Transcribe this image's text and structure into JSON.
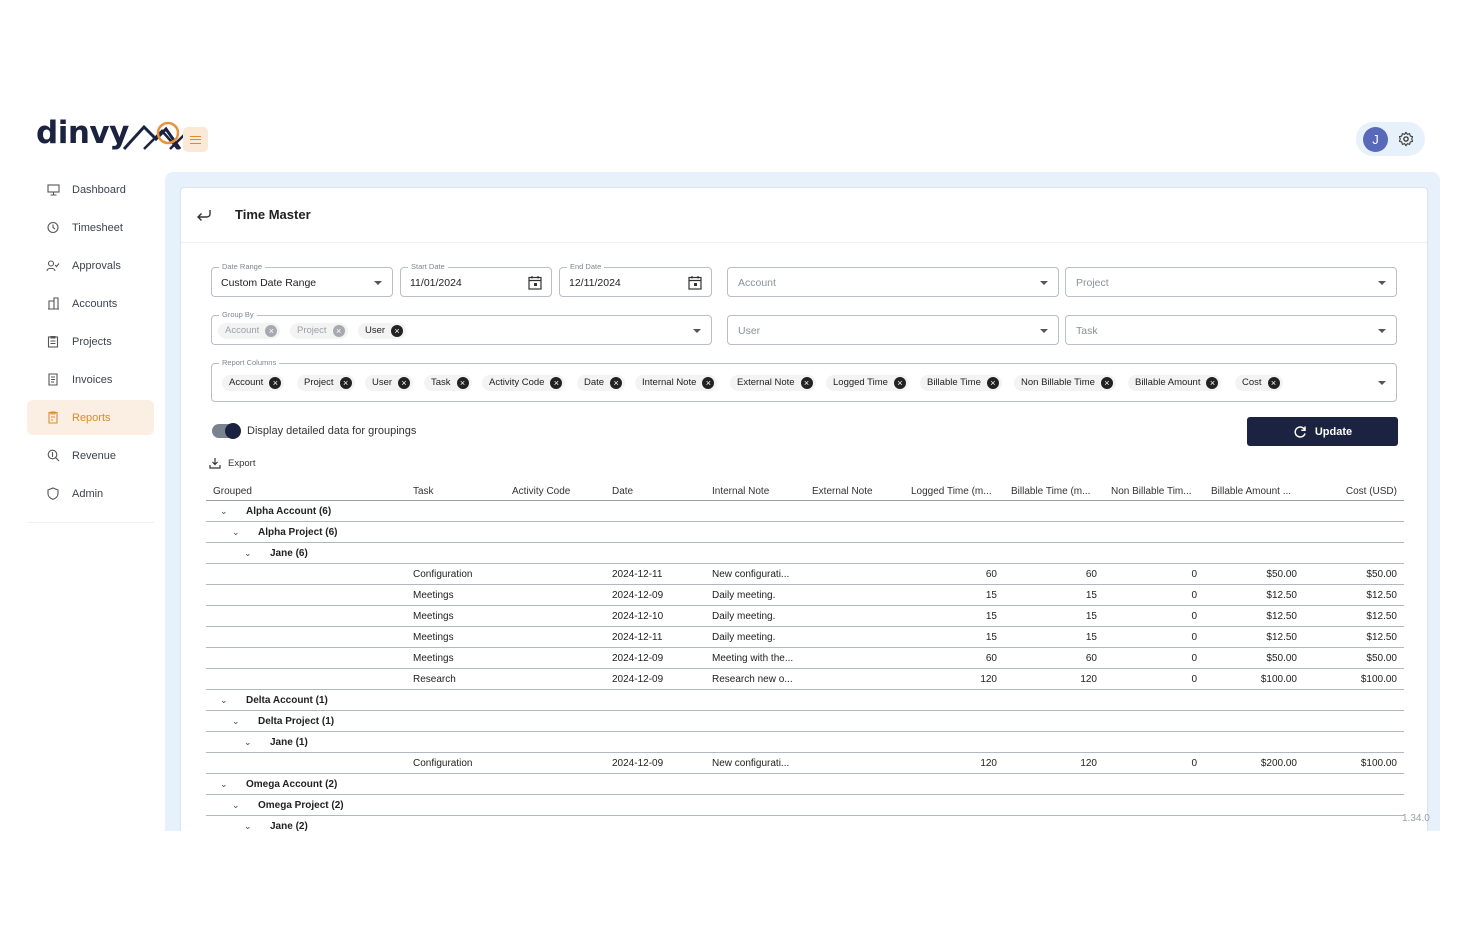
{
  "brand": {
    "name": "dinvy"
  },
  "user": {
    "initial": "J"
  },
  "sidebar": {
    "items": [
      {
        "label": "Dashboard",
        "icon": "dashboard-icon"
      },
      {
        "label": "Timesheet",
        "icon": "timesheet-icon"
      },
      {
        "label": "Approvals",
        "icon": "approvals-icon"
      },
      {
        "label": "Accounts",
        "icon": "accounts-icon"
      },
      {
        "label": "Projects",
        "icon": "projects-icon"
      },
      {
        "label": "Invoices",
        "icon": "invoices-icon"
      },
      {
        "label": "Reports",
        "icon": "reports-icon",
        "active": true
      },
      {
        "label": "Revenue",
        "icon": "revenue-icon"
      },
      {
        "label": "Admin",
        "icon": "admin-icon"
      }
    ]
  },
  "page": {
    "title": "Time Master"
  },
  "filters": {
    "date_range": {
      "label": "Date Range",
      "value": "Custom Date Range"
    },
    "start_date": {
      "label": "Start Date",
      "value": "11/01/2024"
    },
    "end_date": {
      "label": "End Date",
      "value": "12/11/2024"
    },
    "account": {
      "placeholder": "Account"
    },
    "project": {
      "placeholder": "Project"
    },
    "group_by": {
      "label": "Group By",
      "chips": [
        {
          "label": "Account",
          "disabled": true
        },
        {
          "label": "Project",
          "disabled": true
        },
        {
          "label": "User",
          "disabled": false
        }
      ]
    },
    "user": {
      "placeholder": "User"
    },
    "task": {
      "placeholder": "Task"
    },
    "report_columns": {
      "label": "Report Columns",
      "chips": [
        "Account",
        "Project",
        "User",
        "Task",
        "Activity Code",
        "Date",
        "Internal Note",
        "External Note",
        "Logged Time",
        "Billable Time",
        "Non Billable Time",
        "Billable Amount",
        "Cost"
      ]
    }
  },
  "toggle": {
    "label": "Display detailed data for groupings",
    "on": true
  },
  "update_button": {
    "label": "Update"
  },
  "export": {
    "label": "Export"
  },
  "table": {
    "headers": [
      "Grouped",
      "Task",
      "Activity Code",
      "Date",
      "Internal Note",
      "External Note",
      "Logged Time (m...",
      "Billable Time (m...",
      "Non Billable Tim...",
      "Billable Amount ...",
      "Cost (USD)"
    ],
    "rows": [
      {
        "level": 0,
        "group": "Alpha Account (6)"
      },
      {
        "level": 1,
        "group": "Alpha Project (6)"
      },
      {
        "level": 2,
        "group": "Jane (6)"
      },
      {
        "task": "Configuration",
        "date": "2024-12-11",
        "note": "New configurati...",
        "logged": "60",
        "billable": "60",
        "nonbillable": "0",
        "amount": "$50.00",
        "cost": "$50.00"
      },
      {
        "task": "Meetings",
        "date": "2024-12-09",
        "note": "Daily meeting.",
        "logged": "15",
        "billable": "15",
        "nonbillable": "0",
        "amount": "$12.50",
        "cost": "$12.50"
      },
      {
        "task": "Meetings",
        "date": "2024-12-10",
        "note": "Daily meeting.",
        "logged": "15",
        "billable": "15",
        "nonbillable": "0",
        "amount": "$12.50",
        "cost": "$12.50"
      },
      {
        "task": "Meetings",
        "date": "2024-12-11",
        "note": "Daily meeting.",
        "logged": "15",
        "billable": "15",
        "nonbillable": "0",
        "amount": "$12.50",
        "cost": "$12.50"
      },
      {
        "task": "Meetings",
        "date": "2024-12-09",
        "note": "Meeting with the...",
        "logged": "60",
        "billable": "60",
        "nonbillable": "0",
        "amount": "$50.00",
        "cost": "$50.00"
      },
      {
        "task": "Research",
        "date": "2024-12-09",
        "note": "Research new o...",
        "logged": "120",
        "billable": "120",
        "nonbillable": "0",
        "amount": "$100.00",
        "cost": "$100.00"
      },
      {
        "level": 0,
        "group": "Delta Account (1)"
      },
      {
        "level": 1,
        "group": "Delta Project (1)"
      },
      {
        "level": 2,
        "group": "Jane (1)"
      },
      {
        "task": "Configuration",
        "date": "2024-12-09",
        "note": "New configurati...",
        "logged": "120",
        "billable": "120",
        "nonbillable": "0",
        "amount": "$200.00",
        "cost": "$100.00"
      },
      {
        "level": 0,
        "group": "Omega Account (2)"
      },
      {
        "level": 1,
        "group": "Omega Project (2)"
      },
      {
        "level": 2,
        "group": "Jane (2)"
      }
    ]
  },
  "version": "1.34.0"
}
